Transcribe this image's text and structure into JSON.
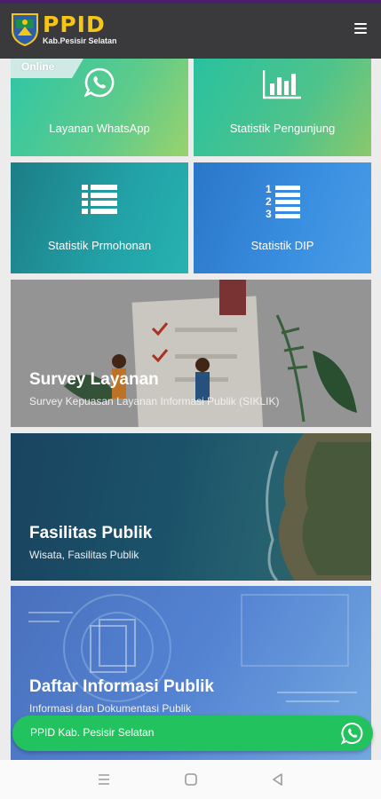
{
  "header": {
    "brand_title": "PPID",
    "brand_subtitle": "Kab.Pesisir Selatan",
    "menu_icon": "hamburger-icon"
  },
  "tiles": [
    {
      "label": "Layanan WhatsApp",
      "icon": "whatsapp-icon",
      "badge": "Online"
    },
    {
      "label": "Statistik Pengunjung",
      "icon": "bar-chart-icon"
    },
    {
      "label": "Statistik Prmohonan",
      "icon": "list-icon"
    },
    {
      "label": "Statistik DIP",
      "icon": "numbered-list-icon"
    }
  ],
  "cards": [
    {
      "title": "Survey Layanan",
      "subtitle": "Survey Kepuasan Layanan Informasi Publik (SIKLIK)"
    },
    {
      "title": "Fasilitas Publik",
      "subtitle": "Wisata, Fasilitas Publik"
    },
    {
      "title": "Daftar Informasi Publik",
      "subtitle": "Informasi dan Dokumentasi Publik"
    }
  ],
  "whatsapp_bar": {
    "label": "PPID Kab. Pesisir Selatan",
    "icon": "whatsapp-icon"
  },
  "android_nav": {
    "items": [
      "recent-apps-icon",
      "home-icon",
      "back-icon"
    ]
  },
  "colors": {
    "header": "#3a3a3d",
    "brand": "#f5c518",
    "whatsapp": "#22c35e"
  }
}
